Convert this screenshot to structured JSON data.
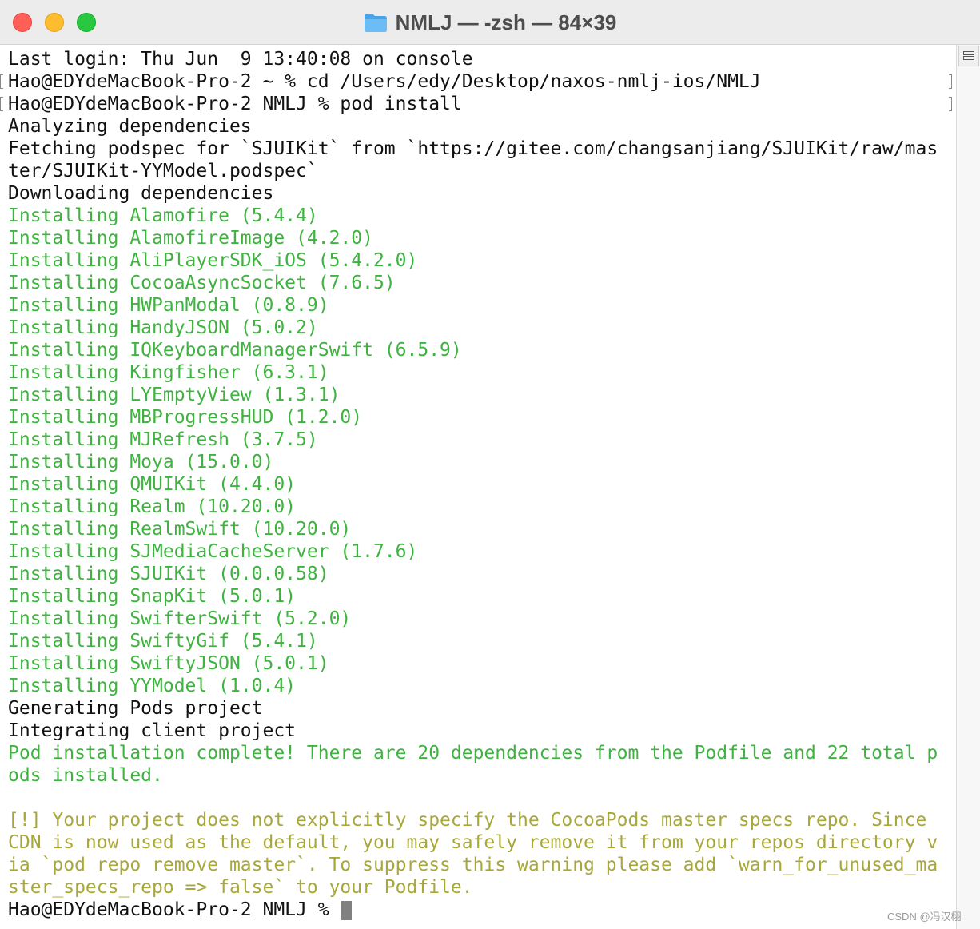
{
  "window": {
    "title": "NMLJ — -zsh — 84×39",
    "folder_icon": "folder-icon",
    "controls": [
      "close",
      "minimize",
      "zoom"
    ],
    "colors": {
      "close": "#ff5f57",
      "minimize": "#febc2e",
      "zoom": "#28c840"
    }
  },
  "terminal": {
    "colors": {
      "default": "#111111",
      "success": "#3fb33f",
      "warning": "#a8a83a"
    },
    "lines": [
      {
        "text": "Last login: Thu Jun  9 13:40:08 on console",
        "style": "default"
      },
      {
        "text": "Hao@EDYdeMacBook-Pro-2 ~ % cd /Users/edy/Desktop/naxos-nmlj-ios/NMLJ",
        "style": "default",
        "marked": true
      },
      {
        "text": "Hao@EDYdeMacBook-Pro-2 NMLJ % pod install",
        "style": "default",
        "marked": true
      },
      {
        "text": "Analyzing dependencies",
        "style": "default"
      },
      {
        "text": "Fetching podspec for `SJUIKit` from `https://gitee.com/changsanjiang/SJUIKit/raw/mas",
        "style": "default"
      },
      {
        "text": "ter/SJUIKit-YYModel.podspec`",
        "style": "default"
      },
      {
        "text": "Downloading dependencies",
        "style": "default"
      },
      {
        "text": "Installing Alamofire (5.4.4)",
        "style": "success"
      },
      {
        "text": "Installing AlamofireImage (4.2.0)",
        "style": "success"
      },
      {
        "text": "Installing AliPlayerSDK_iOS (5.4.2.0)",
        "style": "success"
      },
      {
        "text": "Installing CocoaAsyncSocket (7.6.5)",
        "style": "success"
      },
      {
        "text": "Installing HWPanModal (0.8.9)",
        "style": "success"
      },
      {
        "text": "Installing HandyJSON (5.0.2)",
        "style": "success"
      },
      {
        "text": "Installing IQKeyboardManagerSwift (6.5.9)",
        "style": "success"
      },
      {
        "text": "Installing Kingfisher (6.3.1)",
        "style": "success"
      },
      {
        "text": "Installing LYEmptyView (1.3.1)",
        "style": "success"
      },
      {
        "text": "Installing MBProgressHUD (1.2.0)",
        "style": "success"
      },
      {
        "text": "Installing MJRefresh (3.7.5)",
        "style": "success"
      },
      {
        "text": "Installing Moya (15.0.0)",
        "style": "success"
      },
      {
        "text": "Installing QMUIKit (4.4.0)",
        "style": "success"
      },
      {
        "text": "Installing Realm (10.20.0)",
        "style": "success"
      },
      {
        "text": "Installing RealmSwift (10.20.0)",
        "style": "success"
      },
      {
        "text": "Installing SJMediaCacheServer (1.7.6)",
        "style": "success"
      },
      {
        "text": "Installing SJUIKit (0.0.0.58)",
        "style": "success"
      },
      {
        "text": "Installing SnapKit (5.0.1)",
        "style": "success"
      },
      {
        "text": "Installing SwifterSwift (5.2.0)",
        "style": "success"
      },
      {
        "text": "Installing SwiftyGif (5.4.1)",
        "style": "success"
      },
      {
        "text": "Installing SwiftyJSON (5.0.1)",
        "style": "success"
      },
      {
        "text": "Installing YYModel (1.0.4)",
        "style": "success"
      },
      {
        "text": "Generating Pods project",
        "style": "default"
      },
      {
        "text": "Integrating client project",
        "style": "default"
      },
      {
        "text": "Pod installation complete! There are 20 dependencies from the Podfile and 22 total p",
        "style": "success"
      },
      {
        "text": "ods installed.",
        "style": "success"
      },
      {
        "text": "",
        "style": "default"
      },
      {
        "text": "[!] Your project does not explicitly specify the CocoaPods master specs repo. Since",
        "style": "warning"
      },
      {
        "text": "CDN is now used as the default, you may safely remove it from your repos directory v",
        "style": "warning"
      },
      {
        "text": "ia `pod repo remove master`. To suppress this warning please add `warn_for_unused_ma",
        "style": "warning"
      },
      {
        "text": "ster_specs_repo => false` to your Podfile.",
        "style": "warning"
      }
    ],
    "prompt": "Hao@EDYdeMacBook-Pro-2 NMLJ % "
  },
  "scrollbar": {
    "split_icon": "split-pane-icon"
  },
  "watermark": "CSDN @冯汉栩"
}
